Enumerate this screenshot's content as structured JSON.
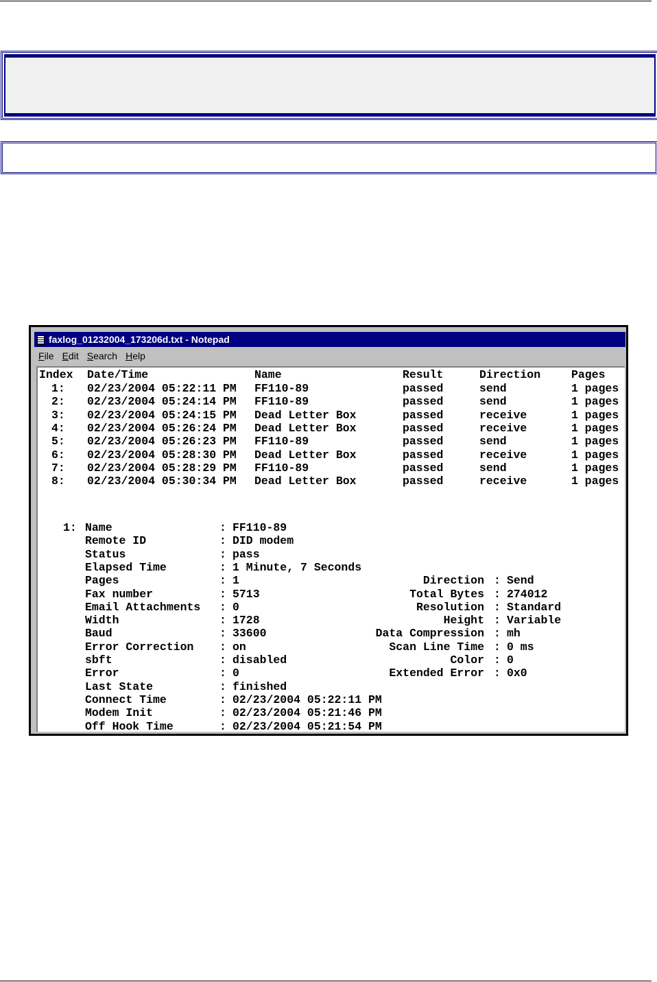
{
  "window": {
    "title": "faxlog_01232004_173206d.txt - Notepad",
    "menu": [
      "File",
      "Edit",
      "Search",
      "Help"
    ]
  },
  "table": {
    "headers": [
      "Index",
      "Date/Time",
      "Name",
      "Result",
      "Direction",
      "Pages"
    ],
    "rows": [
      [
        "1:",
        "02/23/2004 05:22:11 PM",
        "FF110-89",
        "passed",
        "send",
        "1 pages"
      ],
      [
        "2:",
        "02/23/2004 05:24:14 PM",
        "FF110-89",
        "passed",
        "send",
        "1 pages"
      ],
      [
        "3:",
        "02/23/2004 05:24:15 PM",
        "Dead Letter Box",
        "passed",
        "receive",
        "1 pages"
      ],
      [
        "4:",
        "02/23/2004 05:26:24 PM",
        "Dead Letter Box",
        "passed",
        "receive",
        "1 pages"
      ],
      [
        "5:",
        "02/23/2004 05:26:23 PM",
        "FF110-89",
        "passed",
        "send",
        "1 pages"
      ],
      [
        "6:",
        "02/23/2004 05:28:30 PM",
        "Dead Letter Box",
        "passed",
        "receive",
        "1 pages"
      ],
      [
        "7:",
        "02/23/2004 05:28:29 PM",
        "FF110-89",
        "passed",
        "send",
        "1 pages"
      ],
      [
        "8:",
        "02/23/2004 05:30:34 PM",
        "Dead Letter Box",
        "passed",
        "receive",
        "1 pages"
      ]
    ]
  },
  "detail": {
    "index": "1:",
    "left": [
      [
        "Name",
        "FF110-89"
      ],
      [
        "Remote ID",
        "DID modem"
      ],
      [
        "Status",
        "pass"
      ],
      [
        "Elapsed Time",
        "1 Minute, 7 Seconds"
      ],
      [
        "Pages",
        "1"
      ],
      [
        "Fax number",
        "5713"
      ],
      [
        "Email Attachments",
        "0"
      ],
      [
        "Width",
        "1728"
      ],
      [
        "Baud",
        "33600"
      ],
      [
        "Error Correction",
        "on"
      ],
      [
        "sbft",
        "disabled"
      ],
      [
        "Error",
        "0"
      ],
      [
        "Last State",
        "finished"
      ],
      [
        "Connect Time",
        "02/23/2004 05:22:11 PM"
      ],
      [
        "Modem Init",
        "02/23/2004 05:21:46 PM"
      ],
      [
        "Off Hook Time",
        "02/23/2004 05:21:54 PM"
      ]
    ],
    "right": [
      [
        "Direction",
        "Send"
      ],
      [
        "Total Bytes",
        "274012"
      ],
      [
        "Resolution",
        "Standard"
      ],
      [
        "Height",
        "Variable"
      ],
      [
        "Data Compression",
        "mh"
      ],
      [
        "Scan Line Time",
        "0 ms"
      ],
      [
        "Color",
        "0"
      ],
      [
        "Extended Error",
        "0x0"
      ]
    ]
  }
}
